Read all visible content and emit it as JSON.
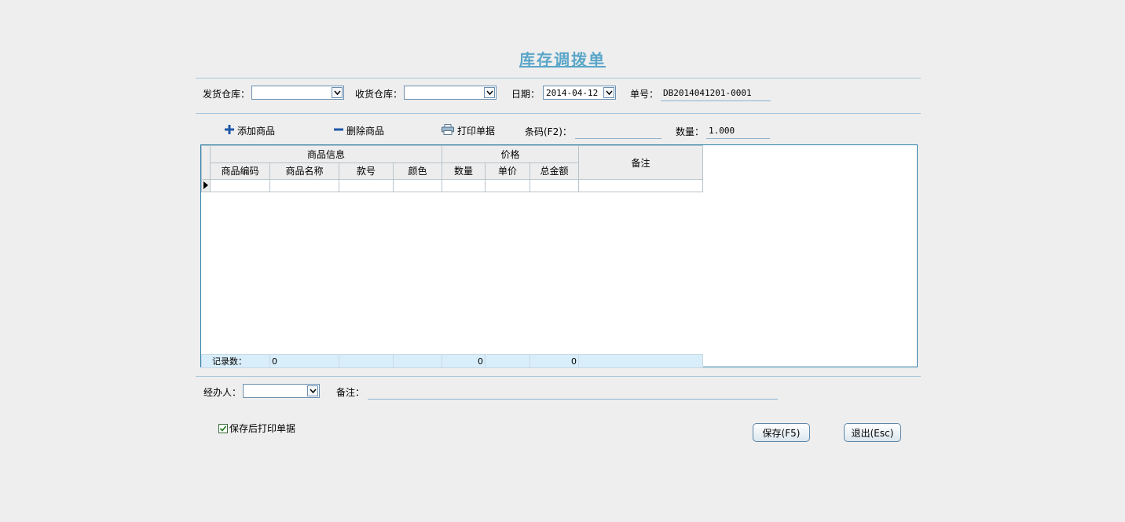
{
  "title": "库存调拨单",
  "header": {
    "from_label": "发货仓库：",
    "from_value": "",
    "to_label": "收货仓库：",
    "to_value": "",
    "date_label": "日期：",
    "date_value": "2014-04-12",
    "no_label": "单号：",
    "no_value": "DB2014041201-0001"
  },
  "toolbar": {
    "add_label": "添加商品",
    "delete_label": "删除商品",
    "print_label": "打印单据",
    "barcode_label": "条码(F2)：",
    "barcode_value": "",
    "qty_label": "数量：",
    "qty_value": "1.000"
  },
  "grid": {
    "group_goods": "商品信息",
    "group_price": "价格",
    "col_remark": "备注",
    "columns": [
      "商品编码",
      "商品名称",
      "款号",
      "颜色",
      "数量",
      "单价",
      "总金额"
    ],
    "footer": {
      "count_label": "记录数：",
      "count_value": "0",
      "qty_total": "0",
      "amount_total": "0"
    }
  },
  "bottom": {
    "handler_label": "经办人：",
    "handler_value": "",
    "remark_label": "备注：",
    "remark_value": "",
    "print_after_save_label": "保存后打印单据",
    "print_after_save_checked": true,
    "save_button": "保存(F5)",
    "exit_button": "退出(Esc)"
  },
  "colors": {
    "background": "#eeeeee",
    "title": "#5aa6c8",
    "accent": "#2a7fa8",
    "footer_row": "#d8eefa"
  }
}
